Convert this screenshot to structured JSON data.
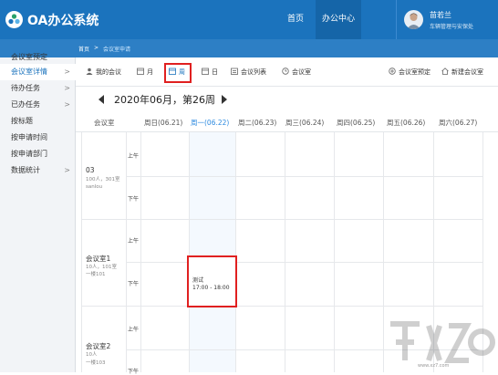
{
  "header": {
    "app_title": "OA办公系统",
    "nav": [
      "首页",
      "办公中心"
    ],
    "user_name": "苗若兰",
    "user_dept": "车辆管理与安保处"
  },
  "breadcrumb": {
    "home": "首页",
    "separator": ">",
    "current": "会议室申请"
  },
  "sidebar": {
    "items": [
      {
        "label": "会议室预定",
        "arrow": ""
      },
      {
        "label": "会议室详情",
        "arrow": ">"
      },
      {
        "label": "待办任务",
        "arrow": ">"
      },
      {
        "label": "已办任务",
        "arrow": ">"
      },
      {
        "label": "按标题",
        "arrow": ""
      },
      {
        "label": "按申请时间",
        "arrow": ""
      },
      {
        "label": "按申请部门",
        "arrow": ""
      },
      {
        "label": "数据统计",
        "arrow": ">"
      }
    ]
  },
  "toolbar": {
    "my_meetings": "我的会议",
    "month": "月",
    "week": "周",
    "day": "日",
    "meeting_list": "会议列表",
    "meeting_room": "会议室",
    "room_booking": "会议室预定",
    "new_room": "新建会议室"
  },
  "week_nav": {
    "title": "2020年06月，第26周"
  },
  "calendar": {
    "room_header": "会议室",
    "days": [
      "周日(06.21)",
      "周一(06.22)",
      "周二(06.23)",
      "周三(06.24)",
      "周四(06.25)",
      "周五(06.26)",
      "周六(06.27)"
    ],
    "periods": {
      "am": "上午",
      "pm": "下午"
    },
    "rooms": [
      {
        "name": "03",
        "info1": "100人，301室",
        "info2": "sanlou"
      },
      {
        "name": "会议室1",
        "info1": "10人，101室",
        "info2": "一楼101"
      },
      {
        "name": "会议室2",
        "info1": "10人",
        "info2": "一楼103"
      }
    ],
    "event": {
      "title": "测试",
      "time": "17:00 - 18:00"
    }
  },
  "watermark": {
    "url": "www.xz7.com"
  },
  "colors": {
    "primary": "#1b73bd",
    "highlight_border": "#e02020",
    "today": "#2d8ae0"
  }
}
